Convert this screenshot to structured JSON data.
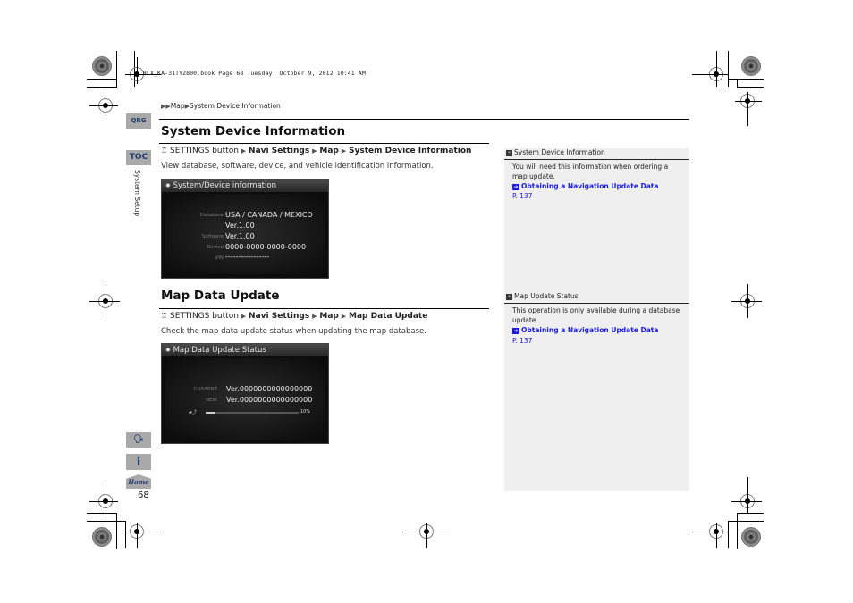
{
  "print_header": "RLX_KA-31TY2800.book  Page 68  Tuesday, October 9, 2012  10:41 AM",
  "breadcrumb": {
    "items": [
      "Map",
      "System Device Information"
    ]
  },
  "side_tabs": {
    "qrg": "QRG",
    "toc": "TOC",
    "chapter": "System Setup",
    "voice_icon": "voice-command-icon",
    "info_icon": "info-icon",
    "home": "Home"
  },
  "page_number": "68",
  "sections": [
    {
      "title": "System Device Information",
      "path": {
        "start": "SETTINGS button",
        "steps": [
          "Navi Settings",
          "Map",
          "System Device Information"
        ]
      },
      "description": "View database, software, device, and vehicle identification information.",
      "screen": {
        "title": "System/Device information",
        "rows": [
          {
            "label": "Database",
            "value": "USA / CANADA / MEXICO"
          },
          {
            "label": "",
            "value": "Ver.1.00"
          },
          {
            "label": "Software",
            "value": "Ver.1.00"
          },
          {
            "label": "Device",
            "value": "0000-0000-0000-0000"
          },
          {
            "label": "VIN",
            "value": "-----------------"
          }
        ]
      }
    },
    {
      "title": "Map Data Update",
      "path": {
        "start": "SETTINGS button",
        "steps": [
          "Navi Settings",
          "Map",
          "Map Data Update"
        ]
      },
      "description": "Check the map data update status when updating the map database.",
      "screen": {
        "title": "Map Data Update Status",
        "rows": [
          {
            "label": "CURRENT",
            "value": "Ver.0000000000000000"
          },
          {
            "label": "NEW",
            "value": "Ver.0000000000000000"
          }
        ],
        "progress_percent": 10,
        "progress_label": "10%"
      }
    }
  ],
  "notes": [
    {
      "heading": "System Device Information",
      "text": "You will need this information when ordering a map update.",
      "link": "Obtaining a Navigation Update Data",
      "page": "P. 137"
    },
    {
      "heading": "Map Update Status",
      "text": "This operation is only available during a database update.",
      "link": "Obtaining a Navigation Update Data",
      "page": "P. 137"
    }
  ]
}
